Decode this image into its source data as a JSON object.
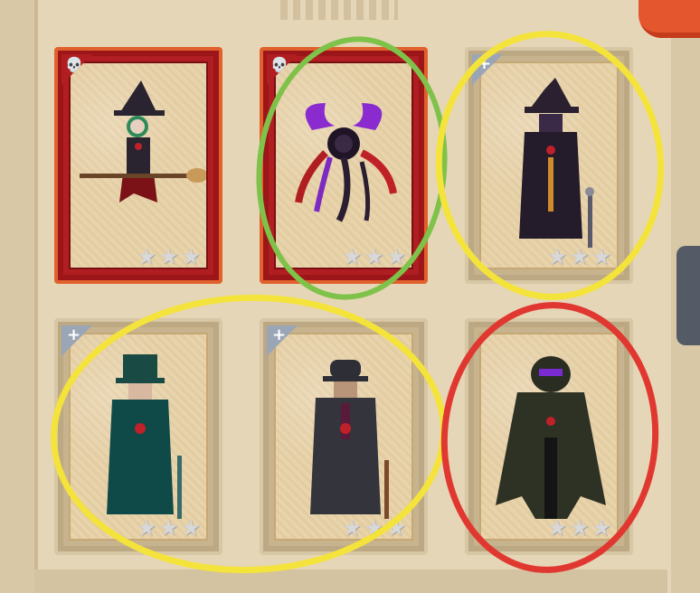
{
  "cards": [
    {
      "character": "witch on broom",
      "rarity": "legendary",
      "badge_icon": "skull-icon",
      "stars": 3
    },
    {
      "character": "purple horned abomination",
      "rarity": "legendary",
      "badge_icon": "skull-icon",
      "stars": 3
    },
    {
      "character": "hooded cane mage",
      "rarity": "common",
      "badge_icon": "plus-icon",
      "stars": 3
    },
    {
      "character": "green top hat gentleman",
      "rarity": "common",
      "badge_icon": "plus-icon",
      "stars": 3
    },
    {
      "character": "grey bowler hat gentleman",
      "rarity": "common",
      "badge_icon": "plus-icon",
      "stars": 3
    },
    {
      "character": "cloaked shadow figure",
      "rarity": "common",
      "badge_icon": "plus-icon",
      "stars": 3
    }
  ],
  "badges": {
    "skull": "💀",
    "plus": "+"
  },
  "star_glyph": "★",
  "annotation_colors": {
    "green": "#7fc24a",
    "yellow": "#f4e33a",
    "red": "#e03830"
  },
  "theme": {
    "legendary_frame": "#b01e22",
    "legendary_border": "#e0612c",
    "common_frame": "#c7b48f",
    "card_face": "#e8d3ab",
    "background": "#e6d6b8"
  }
}
